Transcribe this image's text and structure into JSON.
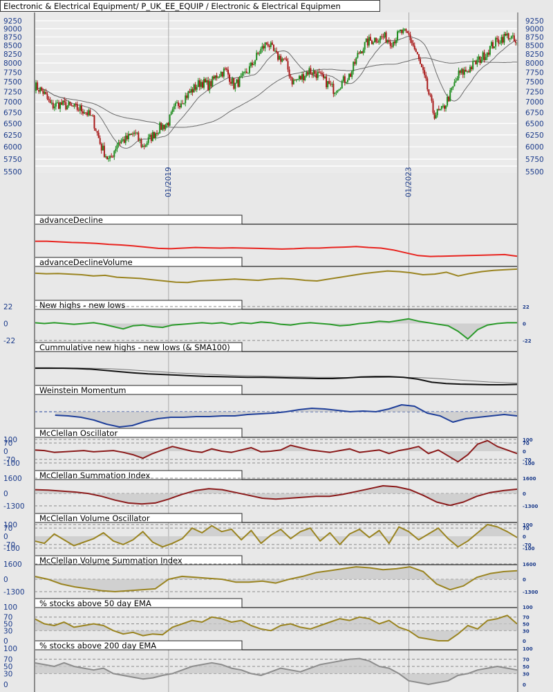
{
  "header": {
    "title": "Electronic & Electrical Equipment/ P_UK_EE_EQUIP / Electronic & Electrical Equipmen"
  },
  "colors": {
    "up": "#1e8c1e",
    "down": "#a81818",
    "label": "#1a3a8a",
    "sma": "#6a6a6a"
  },
  "chart_data": [
    {
      "type": "line",
      "name": "price",
      "title": "Electronic & Electrical Equipment/ P_UK_EE_EQUIP / Electronic & Electrical Equipmen",
      "y_scale": "log",
      "ylim": [
        5500,
        9400
      ],
      "y_ticks": [
        "9250",
        "9000",
        "8750",
        "8500",
        "8250",
        "8000",
        "7750",
        "7500",
        "7250",
        "7000",
        "6750",
        "6500",
        "6250",
        "6000",
        "5750",
        "5500"
      ],
      "x_ticks": [
        {
          "label": "01/2019",
          "year": 2019.0
        },
        {
          "label": "01/2023",
          "year": 2023.0
        }
      ],
      "x_range_years": [
        2016.77,
        2024.8
      ],
      "values": [
        7400,
        7250,
        6900,
        6950,
        6900,
        6850,
        6800,
        6600,
        6000,
        5700,
        6100,
        6150,
        6300,
        6000,
        6200,
        6400,
        6500,
        6900,
        7100,
        7300,
        7500,
        7400,
        7700,
        7800,
        7400,
        7600,
        7900,
        8300,
        8600,
        8200,
        8100,
        7500,
        7600,
        7800,
        7700,
        7500,
        7300,
        7500,
        7700,
        8300,
        8600,
        8700,
        8750,
        8600,
        8900,
        8800,
        8200,
        7500,
        6700,
        6800,
        7200,
        7700,
        7800,
        8000,
        8200,
        8500,
        8700,
        8800,
        8500
      ]
    },
    {
      "type": "line",
      "name": "advanceDecline",
      "title": "advanceDecline",
      "color": "#e8231e",
      "range": [
        0,
        100
      ],
      "values": [
        52,
        52,
        50,
        48,
        47,
        45,
        42,
        40,
        37,
        33,
        29,
        28,
        30,
        32,
        31,
        30,
        31,
        30,
        29,
        28,
        27,
        28,
        30,
        30,
        32,
        33,
        35,
        32,
        30,
        24,
        15,
        6,
        3,
        4,
        5,
        6,
        7,
        8,
        9,
        4
      ],
      "axis_labels": []
    },
    {
      "type": "line",
      "name": "advanceDeclineVolume",
      "title": "advanceDeclineVolume",
      "color": "#9a8420",
      "range": [
        0,
        100
      ],
      "values": [
        85,
        83,
        84,
        82,
        80,
        76,
        78,
        72,
        70,
        68,
        64,
        60,
        56,
        55,
        60,
        62,
        64,
        66,
        64,
        62,
        66,
        68,
        66,
        62,
        60,
        66,
        72,
        78,
        84,
        88,
        92,
        90,
        86,
        80,
        82,
        88,
        76,
        84,
        90,
        94,
        96,
        98
      ],
      "axis_labels": []
    },
    {
      "type": "area",
      "name": "newHighsNewLows",
      "title": "New highs - new lows",
      "color": "#2a9a2a",
      "range": [
        -22,
        22
      ],
      "fill_to": 0,
      "dashed": [
        22,
        -22
      ],
      "values": [
        1,
        0,
        1,
        0,
        -1,
        0,
        1,
        -1,
        -4,
        -7,
        -3,
        -2,
        -4,
        -5,
        -2,
        -1,
        0,
        1,
        0,
        1,
        -1,
        1,
        0,
        2,
        1,
        -1,
        -2,
        0,
        1,
        0,
        -1,
        -3,
        -2,
        0,
        1,
        3,
        2,
        4,
        6,
        3,
        1,
        -1,
        -3,
        -10,
        -20,
        -8,
        -2,
        0,
        1,
        1
      ],
      "axis_labels": [
        {
          "text": "22",
          "v": 22
        },
        {
          "text": "0",
          "v": 0
        },
        {
          "text": "-22",
          "v": -22
        }
      ]
    },
    {
      "type": "line",
      "name": "cumulativeNewHighsNewLows",
      "title": "Cummulative new highs - new lows (& SMA100)",
      "color": "#111111",
      "range": [
        0,
        100
      ],
      "values": [
        53,
        53,
        53,
        52,
        50,
        46,
        42,
        38,
        35,
        33,
        31,
        29,
        27,
        26,
        25,
        24,
        24,
        23,
        22,
        21,
        20,
        20,
        22,
        25,
        26,
        26,
        24,
        18,
        8,
        4,
        2,
        1,
        0,
        0,
        1
      ],
      "sma_values": [
        55,
        55,
        54,
        54,
        53,
        52,
        50,
        47,
        44,
        41,
        38,
        36,
        34,
        32,
        30,
        29,
        28,
        27,
        26,
        25,
        24,
        24,
        23,
        23,
        23,
        24,
        24,
        23,
        21,
        18,
        15,
        12,
        9,
        7,
        5
      ],
      "axis_labels": []
    },
    {
      "type": "area",
      "name": "weinsteinMomentum",
      "title": "Weinstein Momentum",
      "color": "#1f3f9a",
      "range": [
        -25,
        25
      ],
      "fill_to": 0,
      "zero_dashed_blue": true,
      "values": [
        -5,
        -6,
        -8,
        -12,
        -18,
        -22,
        -20,
        -14,
        -10,
        -8,
        -8,
        -7,
        -7,
        -6,
        -6,
        -4,
        -3,
        -2,
        0,
        3,
        5,
        4,
        2,
        0,
        1,
        0,
        4,
        10,
        8,
        -2,
        -6,
        -15,
        -10,
        -8,
        -6,
        -4,
        -6
      ],
      "axis_labels": []
    },
    {
      "type": "area",
      "name": "mcclellanOscillator",
      "title": "McClellan Oscillator",
      "color": "#8b1a1a",
      "range": [
        -100,
        100
      ],
      "fill_to": 0,
      "dashed": [
        100,
        70,
        -70,
        -100
      ],
      "values": [
        10,
        5,
        -10,
        -5,
        0,
        5,
        -5,
        0,
        5,
        -10,
        -30,
        -60,
        -20,
        10,
        40,
        20,
        0,
        -10,
        20,
        0,
        -10,
        10,
        30,
        -5,
        0,
        10,
        50,
        30,
        10,
        0,
        -10,
        5,
        20,
        -10,
        0,
        10,
        -20,
        5,
        20,
        40,
        -20,
        10,
        -40,
        -90,
        -30,
        60,
        90,
        40,
        10,
        -20
      ],
      "axis_labels": [
        {
          "text": "100",
          "v": 100
        },
        {
          "text": "70",
          "v": 70
        },
        {
          "text": "0",
          "v": 0
        },
        {
          "text": "-70",
          "v": -70
        },
        {
          "text": "-100",
          "v": -100
        }
      ]
    },
    {
      "type": "area",
      "name": "mcclellanSummationIndex",
      "title": "McClellan Summation Index",
      "color": "#8b1a1a",
      "range": [
        -1300,
        1600
      ],
      "fill_to": 0,
      "dashed": [
        1600,
        0,
        -1300
      ],
      "values": [
        400,
        350,
        250,
        150,
        0,
        -300,
        -700,
        -1000,
        -1100,
        -1000,
        -600,
        -100,
        300,
        500,
        400,
        100,
        -200,
        -500,
        -600,
        -500,
        -400,
        -300,
        -300,
        -100,
        200,
        500,
        800,
        700,
        400,
        -200,
        -900,
        -1250,
        -900,
        -300,
        100,
        300,
        450
      ],
      "axis_labels": [
        {
          "text": "1600",
          "v": 1600
        },
        {
          "text": "0",
          "v": 0
        },
        {
          "text": "-1300",
          "v": -1300
        }
      ]
    },
    {
      "type": "area",
      "name": "mcclellanVolumeOscillator",
      "title": "McClellan Volume Oscillator",
      "color": "#9a8420",
      "range": [
        -100,
        100
      ],
      "fill_to": 0,
      "dashed": [
        100,
        70,
        -70,
        -100
      ],
      "values": [
        -40,
        -60,
        20,
        -30,
        -80,
        -50,
        -20,
        30,
        -40,
        -70,
        -30,
        40,
        -50,
        -90,
        -60,
        -20,
        70,
        30,
        90,
        40,
        60,
        -30,
        50,
        -60,
        10,
        60,
        -20,
        40,
        70,
        -40,
        30,
        -70,
        20,
        60,
        -10,
        50,
        -60,
        80,
        40,
        -30,
        20,
        70,
        -20,
        -90,
        -40,
        30,
        100,
        80,
        40,
        -10
      ],
      "axis_labels": [
        {
          "text": "100",
          "v": 100
        },
        {
          "text": "70",
          "v": 70
        },
        {
          "text": "0",
          "v": 0
        },
        {
          "text": "-70",
          "v": -70
        },
        {
          "text": "-100",
          "v": -100
        }
      ]
    },
    {
      "type": "area",
      "name": "mcclellanVolumeSummationIndex",
      "title": "McClellan Volume Summation Index",
      "color": "#9a8420",
      "range": [
        -1300,
        1600
      ],
      "fill_to": 0,
      "dashed": [
        1600,
        0,
        -1300
      ],
      "values": [
        300,
        0,
        -500,
        -800,
        -1000,
        -1200,
        -1300,
        -1200,
        -1100,
        -1000,
        0,
        300,
        200,
        100,
        0,
        -300,
        -300,
        -200,
        -400,
        0,
        300,
        700,
        900,
        1100,
        1300,
        1200,
        1000,
        1100,
        1300,
        800,
        -500,
        -1100,
        -700,
        200,
        600,
        800,
        900
      ],
      "axis_labels": [
        {
          "text": "1600",
          "v": 1600
        },
        {
          "text": "0",
          "v": 0
        },
        {
          "text": "-1300",
          "v": -1300
        }
      ]
    },
    {
      "type": "area",
      "name": "pctAbove50EMA",
      "title": "% stocks above 50 day EMA",
      "color": "#9a8420",
      "range": [
        0,
        100
      ],
      "fill_to": 30,
      "dashed": [
        70,
        50,
        30
      ],
      "values": [
        65,
        50,
        45,
        55,
        40,
        45,
        50,
        45,
        30,
        20,
        25,
        15,
        20,
        18,
        40,
        50,
        60,
        55,
        70,
        65,
        55,
        60,
        45,
        35,
        30,
        45,
        50,
        40,
        35,
        45,
        55,
        65,
        60,
        70,
        65,
        50,
        60,
        40,
        30,
        10,
        5,
        0,
        0,
        20,
        45,
        35,
        60,
        65,
        75,
        50
      ],
      "axis_labels": [
        {
          "text": "100",
          "v": 100
        },
        {
          "text": "70",
          "v": 70
        },
        {
          "text": "50",
          "v": 50
        },
        {
          "text": "30",
          "v": 30
        },
        {
          "text": "0",
          "v": 0
        }
      ]
    },
    {
      "type": "area",
      "name": "pctAbove200EMA",
      "title": "% stocks above 200 day EMA",
      "color": "#8c8c8c",
      "range": [
        0,
        100
      ],
      "fill_to": 30,
      "dashed": [
        70,
        50,
        30
      ],
      "values": [
        60,
        55,
        50,
        60,
        50,
        45,
        40,
        45,
        30,
        25,
        20,
        15,
        18,
        25,
        30,
        40,
        50,
        55,
        60,
        55,
        45,
        40,
        30,
        25,
        35,
        45,
        40,
        35,
        45,
        55,
        60,
        65,
        70,
        72,
        65,
        50,
        45,
        30,
        10,
        5,
        0,
        5,
        10,
        25,
        30,
        40,
        45,
        50,
        45,
        40
      ],
      "axis_labels": [
        {
          "text": "100",
          "v": 100
        },
        {
          "text": "70",
          "v": 70
        },
        {
          "text": "50",
          "v": 50
        },
        {
          "text": "30",
          "v": 30
        },
        {
          "text": "0",
          "v": 0
        }
      ]
    }
  ]
}
